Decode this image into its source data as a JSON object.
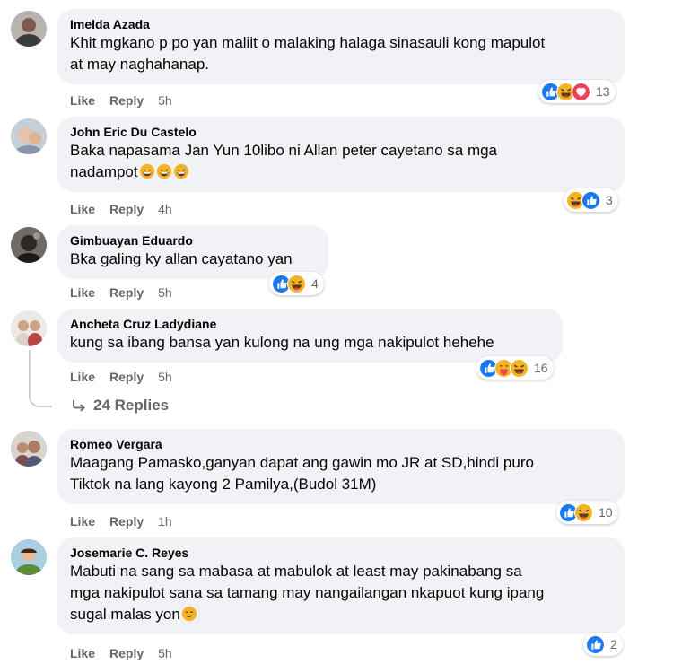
{
  "comments": [
    {
      "author": "Imelda Azada",
      "line1": "Khit mgkano p po yan maliit o malaking halaga sinasauli kong mapulot",
      "line2": "at may naghahanap.",
      "like": "Like",
      "reply": "Reply",
      "time": "5h",
      "reactions": [
        "like-icon",
        "haha-icon",
        "love-icon"
      ],
      "count": "13"
    },
    {
      "author": "John Eric Du Castelo",
      "line1": "Baka napasama Jan Yun 10libo ni Allan peter cayetano sa mga",
      "line2": "nadampot",
      "like": "Like",
      "reply": "Reply",
      "time": "4h",
      "reactions": [
        "haha-icon",
        "like-icon"
      ],
      "count": "3"
    },
    {
      "author": "Gimbuayan Eduardo",
      "line1": "Bka galing ky allan cayatano yan",
      "like": "Like",
      "reply": "Reply",
      "time": "5h",
      "reactions": [
        "like-icon",
        "haha-icon"
      ],
      "count": "4"
    },
    {
      "author": "Ancheta Cruz Ladydiane",
      "line1": "kung sa ibang bansa yan kulong na ung mga nakipulot hehehe",
      "like": "Like",
      "reply": "Reply",
      "time": "5h",
      "reactions": [
        "like-icon",
        "care-icon",
        "haha-icon"
      ],
      "count": "16",
      "replies": "24 Replies"
    },
    {
      "author": "Romeo Vergara",
      "line1": "Maagang Pamasko,ganyan dapat ang gawin mo JR at SD,hindi puro",
      "line2": "Tiktok na lang kayong 2 Pamilya,(Budol 31M)",
      "like": "Like",
      "reply": "Reply",
      "time": "1h",
      "reactions": [
        "like-icon",
        "haha-icon"
      ],
      "count": "10"
    },
    {
      "author": "Josemarie C. Reyes",
      "line1": "Mabuti na sang sa mabasa at mabulok at least may pakinabang sa",
      "line2": "mga nakipulot sana sa tamang may nangailangan nkapuot kung ipang",
      "line3": "sugal malas yon",
      "like": "Like",
      "reply": "Reply",
      "time": "5h",
      "reactions": [
        "like-icon"
      ],
      "count": "2"
    }
  ],
  "colors": {
    "bubble": "#f0f2f5",
    "like_blue": "#1877f2",
    "love_red": "#f33e58",
    "haha_yellow": "#f7b125",
    "meta_gray": "#65676b"
  }
}
